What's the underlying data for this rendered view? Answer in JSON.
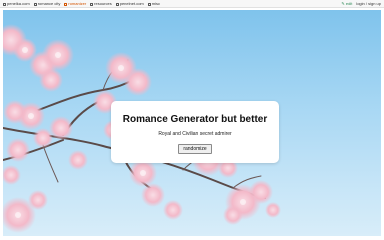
{
  "nav": {
    "items": [
      {
        "label": "penelka.com",
        "icon": "home-icon"
      },
      {
        "label": "romance city",
        "icon": "city-icon"
      },
      {
        "label": "romanizer",
        "icon": "heart-icon",
        "active": true
      },
      {
        "label": "resources",
        "icon": "book-icon"
      },
      {
        "label": "penelnet.com",
        "icon": "globe-icon"
      },
      {
        "label": "misc",
        "icon": "folder-icon"
      }
    ],
    "edit_label": "✎ edit",
    "login_label": "login / sign up"
  },
  "card": {
    "title": "Romance Generator but better",
    "subtitle": "Royal and Civilian secret admirer",
    "button_label": "randomize"
  },
  "colors": {
    "accent": "#d35400",
    "sky": "#9fd2f2",
    "blossom": "#f6c6d3"
  }
}
